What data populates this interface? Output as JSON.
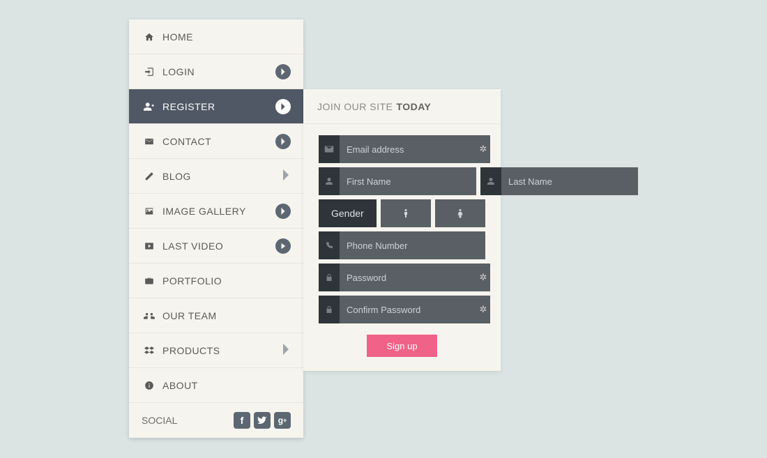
{
  "sidebar": {
    "items": [
      {
        "icon": "home",
        "label": "HOME",
        "arrow": "none"
      },
      {
        "icon": "login",
        "label": "LOGIN",
        "arrow": "circle"
      },
      {
        "icon": "user-plus",
        "label": "REGISTER",
        "arrow": "circle",
        "active": true
      },
      {
        "icon": "envelope",
        "label": "CONTACT",
        "arrow": "circle"
      },
      {
        "icon": "edit",
        "label": "BLOG",
        "arrow": "plain"
      },
      {
        "icon": "image",
        "label": "IMAGE GALLERY",
        "arrow": "circle"
      },
      {
        "icon": "video",
        "label": "LAST VIDEO",
        "arrow": "play"
      },
      {
        "icon": "briefcase",
        "label": "PORTFOLIO",
        "arrow": "none"
      },
      {
        "icon": "team",
        "label": "OUR TEAM",
        "arrow": "none"
      },
      {
        "icon": "dropbox",
        "label": "PRODUCTS",
        "arrow": "plain"
      },
      {
        "icon": "info",
        "label": "ABOUT",
        "arrow": "none"
      }
    ],
    "social": {
      "label": "SOCIAL"
    }
  },
  "panel": {
    "header_plain": "JOIN OUR SITE",
    "header_bold": "TODAY",
    "email_placeholder": "Email address",
    "firstname_placeholder": "First Name",
    "lastname_placeholder": "Last Name",
    "gender_label": "Gender",
    "phone_placeholder": "Phone Number",
    "password_placeholder": "Password",
    "confirm_placeholder": "Confirm Password",
    "signup_label": "Sign up"
  }
}
